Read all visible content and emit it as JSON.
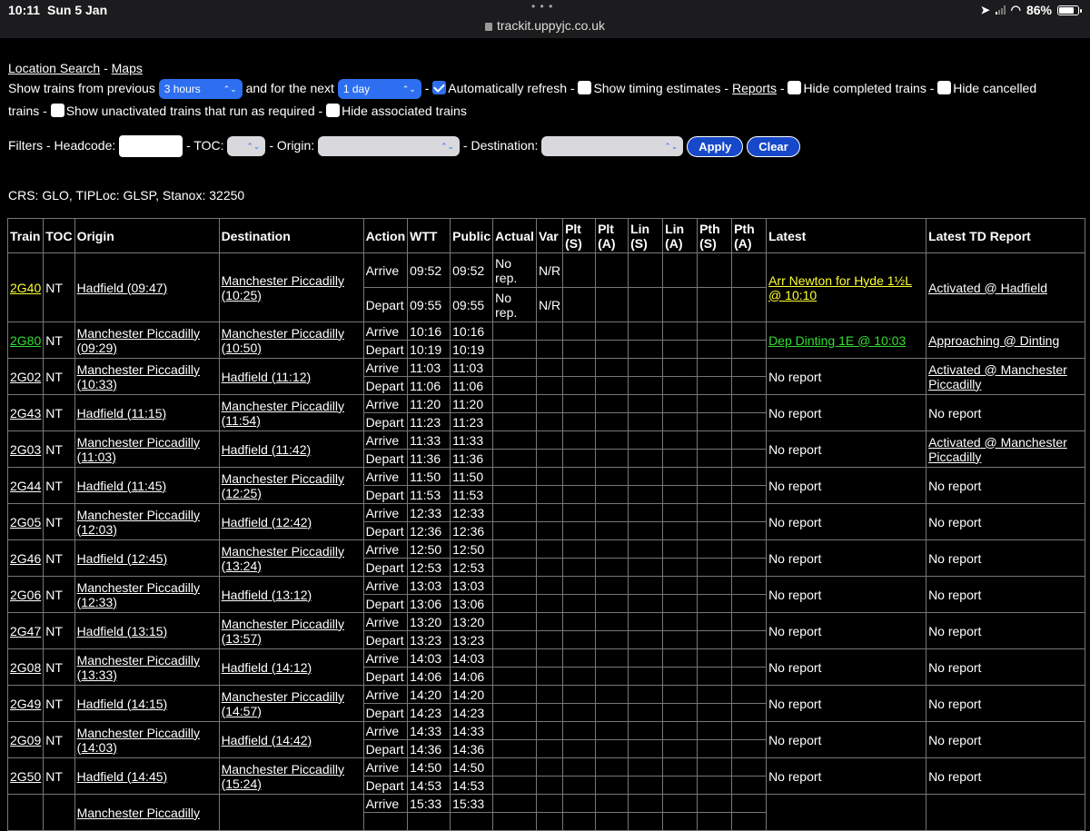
{
  "statusbar": {
    "time": "10:11",
    "date": "Sun 5 Jan",
    "dots": "• • •",
    "url": "trackit.uppyjc.co.uk",
    "battery": "86%",
    "battery_level": 0.86
  },
  "nav": {
    "location_search": "Location Search",
    "sep": "-",
    "maps": "Maps"
  },
  "controls": {
    "show_from_label": "Show trains from previous",
    "previous_value": "3 hours",
    "next_label": "and for the next",
    "next_value": "1 day",
    "auto_refresh": "Automatically refresh",
    "timing_estimates": "Show timing estimates",
    "reports": "Reports",
    "hide_completed": "Hide completed trains",
    "hide_cancelled_a": "Hide cancelled",
    "hide_cancelled_b": "trains",
    "unactivated": "Show unactivated trains that run as required",
    "hide_associated": "Hide associated trains"
  },
  "filters": {
    "filters_headcode": "Filters - Headcode:",
    "toc": "- TOC:",
    "origin": "- Origin:",
    "destination": "- Destination:",
    "apply": "Apply",
    "clear": "Clear"
  },
  "location_info": "CRS: GLO, TIPLoc: GLSP, Stanox: 32250",
  "headers": {
    "train": "Train",
    "toc": "TOC",
    "origin": "Origin",
    "destination": "Destination",
    "action": "Action",
    "wtt": "WTT",
    "public": "Public",
    "actual": "Actual",
    "var": "Var",
    "plt_s": "Plt (S)",
    "plt_a": "Plt (A)",
    "lin_s": "Lin (S)",
    "lin_a": "Lin (A)",
    "pth_s": "Pth (S)",
    "pth_a": "Pth (A)",
    "latest": "Latest",
    "latest_td": "Latest TD Report"
  },
  "trains": [
    {
      "id": "2G40",
      "toc": "NT",
      "origin": "Hadfield (09:47)",
      "dest": "Manchester Piccadilly (10:25)",
      "arr": "09:52",
      "dep": "09:55",
      "arr_pub": "09:52",
      "dep_pub": "09:55",
      "arr_actual": "No rep.",
      "dep_actual": "No rep.",
      "arr_var": "N/R",
      "dep_var": "N/R",
      "latest": "Arr Newton for Hyde 1½L @ 10:10",
      "td": "Activated @ Hadfield",
      "color": "yellow"
    },
    {
      "id": "2G80",
      "toc": "NT",
      "origin": "Manchester Piccadilly (09:29)",
      "dest": "Manchester Piccadilly (10:50)",
      "arr": "10:16",
      "dep": "10:19",
      "arr_pub": "10:16",
      "dep_pub": "10:19",
      "latest": "Dep Dinting 1E @ 10:03",
      "td": "Approaching @ Dinting",
      "color": "green"
    },
    {
      "id": "2G02",
      "toc": "NT",
      "origin": "Manchester Piccadilly (10:33)",
      "dest": "Hadfield (11:12)",
      "arr": "11:03",
      "dep": "11:06",
      "arr_pub": "11:03",
      "dep_pub": "11:06",
      "latest": "No report",
      "td": "Activated @ Manchester Piccadilly",
      "color": ""
    },
    {
      "id": "2G43",
      "toc": "NT",
      "origin": "Hadfield (11:15)",
      "dest": "Manchester Piccadilly (11:54)",
      "arr": "11:20",
      "dep": "11:23",
      "arr_pub": "11:20",
      "dep_pub": "11:23",
      "latest": "No report",
      "td": "No report",
      "color": ""
    },
    {
      "id": "2G03",
      "toc": "NT",
      "origin": "Manchester Piccadilly (11:03)",
      "dest": "Hadfield (11:42)",
      "arr": "11:33",
      "dep": "11:36",
      "arr_pub": "11:33",
      "dep_pub": "11:36",
      "latest": "No report",
      "td": "Activated @ Manchester Piccadilly",
      "color": ""
    },
    {
      "id": "2G44",
      "toc": "NT",
      "origin": "Hadfield (11:45)",
      "dest": "Manchester Piccadilly (12:25)",
      "arr": "11:50",
      "dep": "11:53",
      "arr_pub": "11:50",
      "dep_pub": "11:53",
      "latest": "No report",
      "td": "No report",
      "color": ""
    },
    {
      "id": "2G05",
      "toc": "NT",
      "origin": "Manchester Piccadilly (12:03)",
      "dest": "Hadfield (12:42)",
      "arr": "12:33",
      "dep": "12:36",
      "arr_pub": "12:33",
      "dep_pub": "12:36",
      "latest": "No report",
      "td": "No report",
      "color": ""
    },
    {
      "id": "2G46",
      "toc": "NT",
      "origin": "Hadfield (12:45)",
      "dest": "Manchester Piccadilly (13:24)",
      "arr": "12:50",
      "dep": "12:53",
      "arr_pub": "12:50",
      "dep_pub": "12:53",
      "latest": "No report",
      "td": "No report",
      "color": ""
    },
    {
      "id": "2G06",
      "toc": "NT",
      "origin": "Manchester Piccadilly (12:33)",
      "dest": "Hadfield (13:12)",
      "arr": "13:03",
      "dep": "13:06",
      "arr_pub": "13:03",
      "dep_pub": "13:06",
      "latest": "No report",
      "td": "No report",
      "color": ""
    },
    {
      "id": "2G47",
      "toc": "NT",
      "origin": "Hadfield (13:15)",
      "dest": "Manchester Piccadilly (13:57)",
      "arr": "13:20",
      "dep": "13:23",
      "arr_pub": "13:20",
      "dep_pub": "13:23",
      "latest": "No report",
      "td": "No report",
      "color": ""
    },
    {
      "id": "2G08",
      "toc": "NT",
      "origin": "Manchester Piccadilly (13:33)",
      "dest": "Hadfield (14:12)",
      "arr": "14:03",
      "dep": "14:06",
      "arr_pub": "14:03",
      "dep_pub": "14:06",
      "latest": "No report",
      "td": "No report",
      "color": ""
    },
    {
      "id": "2G49",
      "toc": "NT",
      "origin": "Hadfield (14:15)",
      "dest": "Manchester Piccadilly (14:57)",
      "arr": "14:20",
      "dep": "14:23",
      "arr_pub": "14:20",
      "dep_pub": "14:23",
      "latest": "No report",
      "td": "No report",
      "color": ""
    },
    {
      "id": "2G09",
      "toc": "NT",
      "origin": "Manchester Piccadilly (14:03)",
      "dest": "Hadfield (14:42)",
      "arr": "14:33",
      "dep": "14:36",
      "arr_pub": "14:33",
      "dep_pub": "14:36",
      "latest": "No report",
      "td": "No report",
      "color": ""
    },
    {
      "id": "2G50",
      "toc": "NT",
      "origin": "Hadfield (14:45)",
      "dest": "Manchester Piccadilly (15:24)",
      "arr": "14:50",
      "dep": "14:53",
      "arr_pub": "14:50",
      "dep_pub": "14:53",
      "latest": "No report",
      "td": "No report",
      "color": ""
    },
    {
      "id": "",
      "toc": "",
      "origin": "Manchester Piccadilly",
      "dest": "",
      "arr": "15:33",
      "dep": "",
      "arr_pub": "15:33",
      "dep_pub": "",
      "latest": "",
      "td": "",
      "color": ""
    }
  ],
  "labels": {
    "arrive": "Arrive",
    "depart": "Depart"
  },
  "colors": {
    "accent": "#2d6ff0",
    "yellow": "#ffff33",
    "green": "#33dd33"
  }
}
